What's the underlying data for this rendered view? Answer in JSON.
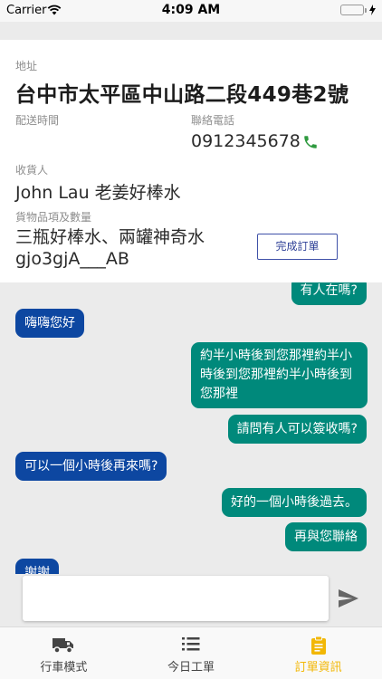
{
  "status_bar": {
    "carrier": "Carrier",
    "time": "4:09 AM"
  },
  "order": {
    "address_label": "地址",
    "address": "台中市太平區中山路二段449巷2號",
    "delivery_time_label": "配送時間",
    "phone_label": "聯絡電話",
    "phone": "0912345678",
    "receiver_label": "收貨人",
    "receiver": "John Lau 老姜好棒水",
    "goods_label": "貨物品項及數量",
    "goods": "三瓶好棒水、兩罐神奇水gjo3gjA___AB",
    "complete_button": "完成訂單"
  },
  "chat": {
    "messages": [
      {
        "direction": "outgoing",
        "text": "有人在嗎?"
      },
      {
        "direction": "incoming",
        "text": "嗨嗨您好"
      },
      {
        "direction": "outgoing",
        "text": "約半小時後到您那裡約半小時後到您那裡約半小時後到您那裡"
      },
      {
        "direction": "outgoing",
        "text": "請問有人可以簽收嗎?"
      },
      {
        "direction": "incoming",
        "text": "可以一個小時後再來嗎?"
      },
      {
        "direction": "outgoing",
        "text": "好的一個小時後過去。"
      },
      {
        "direction": "outgoing",
        "text": "再與您聯絡"
      },
      {
        "direction": "incoming",
        "text": "謝謝"
      }
    ],
    "input_value": "",
    "input_placeholder": ""
  },
  "tabs": [
    {
      "label": "行車模式",
      "icon": "truck-icon",
      "active": false
    },
    {
      "label": "今日工單",
      "icon": "list-icon",
      "active": false
    },
    {
      "label": "訂單資訊",
      "icon": "clipboard-icon",
      "active": true
    }
  ],
  "colors": {
    "outgoing_bubble": "#00897b",
    "incoming_bubble": "#0d47a1",
    "active_tab": "#f2b705",
    "phone_icon": "#2e9a3f",
    "button_border": "#3f51a8"
  }
}
